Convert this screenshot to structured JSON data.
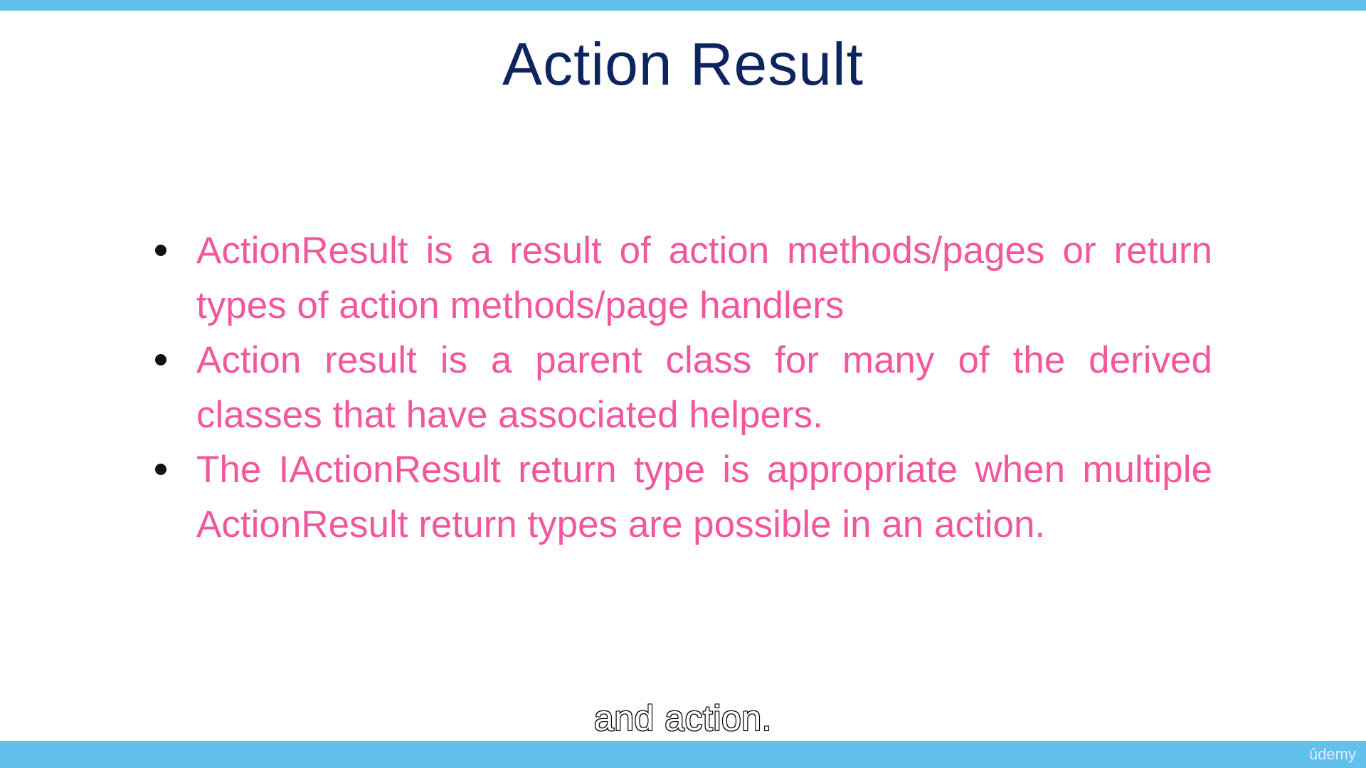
{
  "slide": {
    "title": "Action Result",
    "bullets": [
      {
        "text": "ActionResult is a result of action methods/pages or return types of action methods/page handlers"
      },
      {
        "text": "Action result is a parent class for many of the derived classes that have associated helpers."
      },
      {
        "text": "The IActionResult return type is appropriate when multiple ActionResult return types are possible in an action."
      }
    ]
  },
  "caption": {
    "text": "and action."
  },
  "watermark": {
    "text": "ûdemy"
  },
  "colors": {
    "accent_bar": "#63bfec",
    "title": "#0d2461",
    "bullet_text": "#f2579e"
  }
}
